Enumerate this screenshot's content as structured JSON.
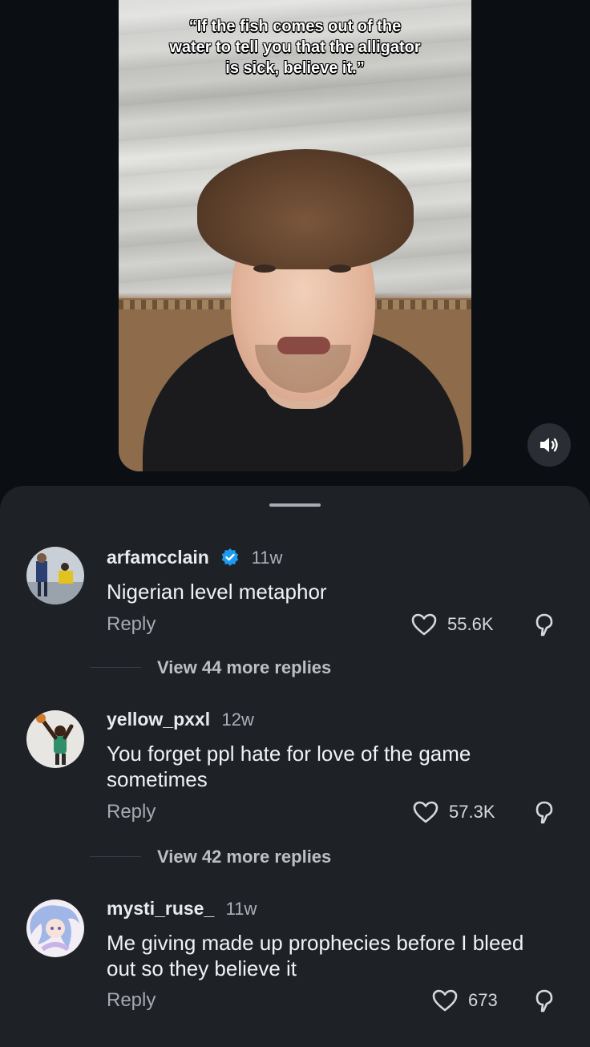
{
  "video": {
    "caption_lines": [
      "“If the fish comes out of the",
      "water to tell you that the alligator",
      "is sick, believe it.”"
    ]
  },
  "comments": [
    {
      "username": "arfamcclain",
      "verified": true,
      "time": "11w",
      "text": "Nigerian level metaphor",
      "reply_label": "Reply",
      "likes": "55.6K",
      "view_more": "View 44 more replies"
    },
    {
      "username": "yellow_pxxl",
      "verified": false,
      "time": "12w",
      "text": "You forget ppl hate for love of the game sometimes",
      "reply_label": "Reply",
      "likes": "57.3K",
      "view_more": "View 42 more replies"
    },
    {
      "username": "mysti_ruse_",
      "verified": false,
      "time": "11w",
      "text": "Me giving made up prophecies before I bleed out so they believe it",
      "reply_label": "Reply",
      "likes": "673"
    }
  ],
  "colors": {
    "background": "#0b0f14",
    "sheet": "#1e2227",
    "verified_badge": "#1d9bf0"
  },
  "icons": [
    "speaker-icon",
    "verified-badge-icon",
    "heart-icon",
    "dislike-icon"
  ]
}
